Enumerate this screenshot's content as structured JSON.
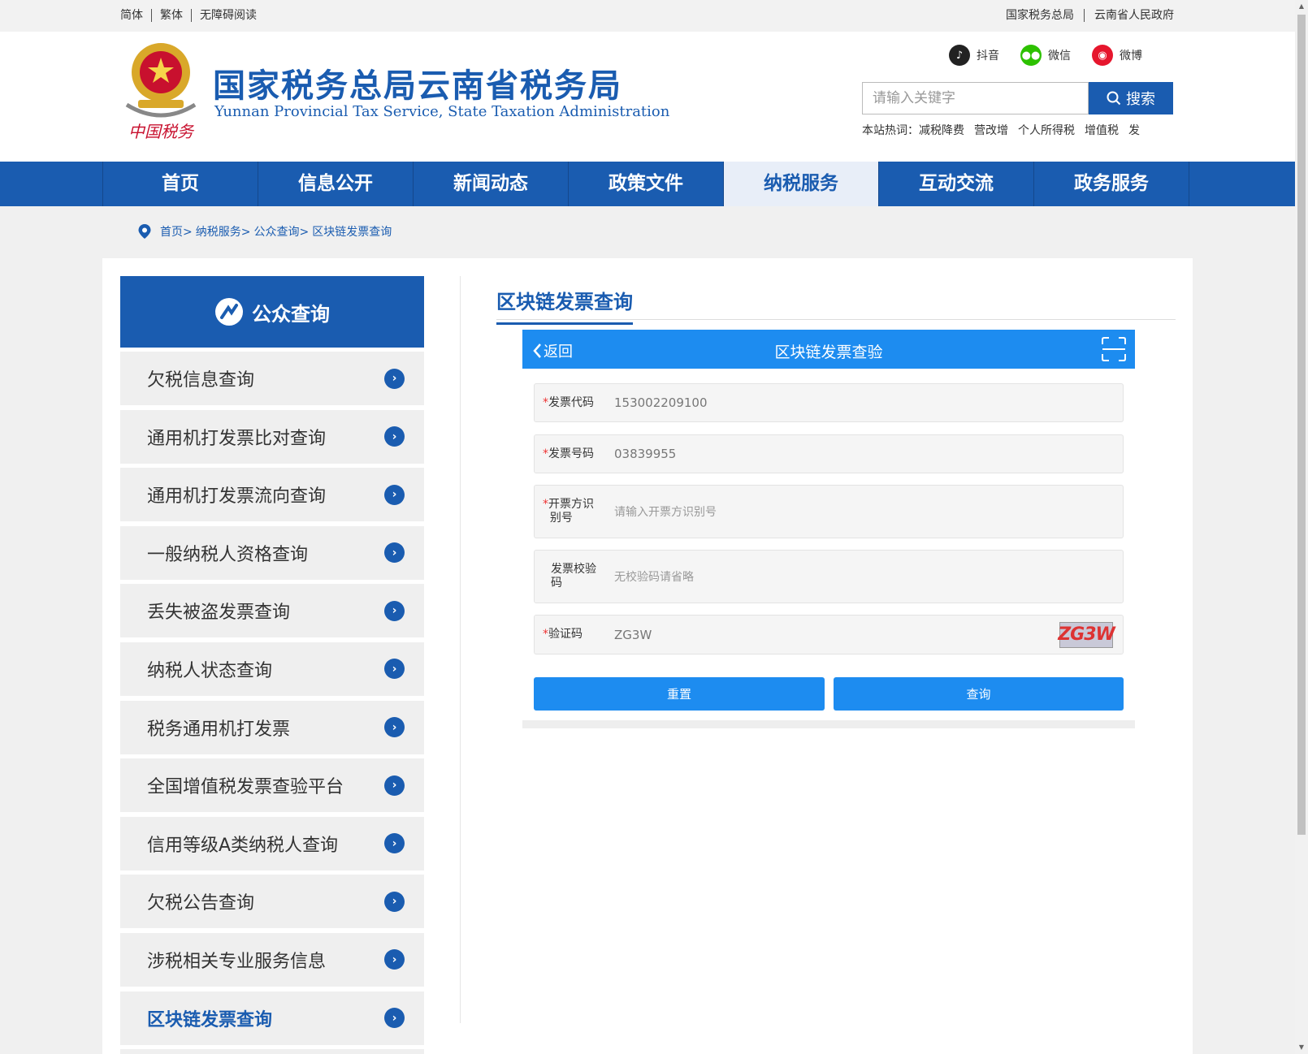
{
  "topbar": {
    "lang_simplified": "简体",
    "lang_traditional": "繁体",
    "accessibility": "无障碍阅读",
    "link_sat": "国家税务总局",
    "link_gov": "云南省人民政府"
  },
  "header": {
    "title": "国家税务总局云南省税务局",
    "subtitle": "Yunnan Provincial Tax Service, State Taxation Administration",
    "seal_text": "中国税务",
    "socials": {
      "douyin": "抖音",
      "wechat": "微信",
      "weibo": "微博"
    },
    "search_placeholder": "请输入关键字",
    "search_button": "搜索",
    "hot_label": "本站热词：",
    "hot_words": [
      "减税降费",
      "营改增",
      "个人所得税",
      "增值税",
      "发"
    ]
  },
  "nav": [
    "首页",
    "信息公开",
    "新闻动态",
    "政策文件",
    "纳税服务",
    "互动交流",
    "政务服务"
  ],
  "nav_active_index": 4,
  "breadcrumb": [
    "首页>",
    "纳税服务>",
    "公众查询>",
    "区块链发票查询"
  ],
  "sidebar": {
    "title": "公众查询",
    "items": [
      "欠税信息查询",
      "通用机打发票比对查询",
      "通用机打发票流向查询",
      "一般纳税人资格查询",
      "丢失被盗发票查询",
      "纳税人状态查询",
      "税务通用机打发票",
      "全国增值税发票查验平台",
      "信用等级A类纳税人查询",
      "欠税公告查询",
      "涉税相关专业服务信息",
      "区块链发票查询"
    ],
    "active_index": 11
  },
  "content": {
    "title": "区块链发票查询",
    "form": {
      "back_label": "返回",
      "bar_title": "区块链发票查验",
      "fields": {
        "code_label": "发票代码",
        "code_value": "153002209100",
        "number_label": "发票号码",
        "number_value": "03839955",
        "issuer_label_1": "开票方识",
        "issuer_label_2": "别号",
        "issuer_placeholder": "请输入开票方识别号",
        "check_label_1": "发票校验",
        "check_label_2": "码",
        "check_placeholder": "无校验码请省略",
        "captcha_label": "验证码",
        "captcha_value": "ZG3W",
        "captcha_image_text": "ZG3W"
      },
      "reset_button": "重置",
      "query_button": "查询"
    }
  },
  "colors": {
    "brand": "#1a5cb0",
    "form_accent": "#1d8cf0",
    "required": "#ee3333"
  }
}
